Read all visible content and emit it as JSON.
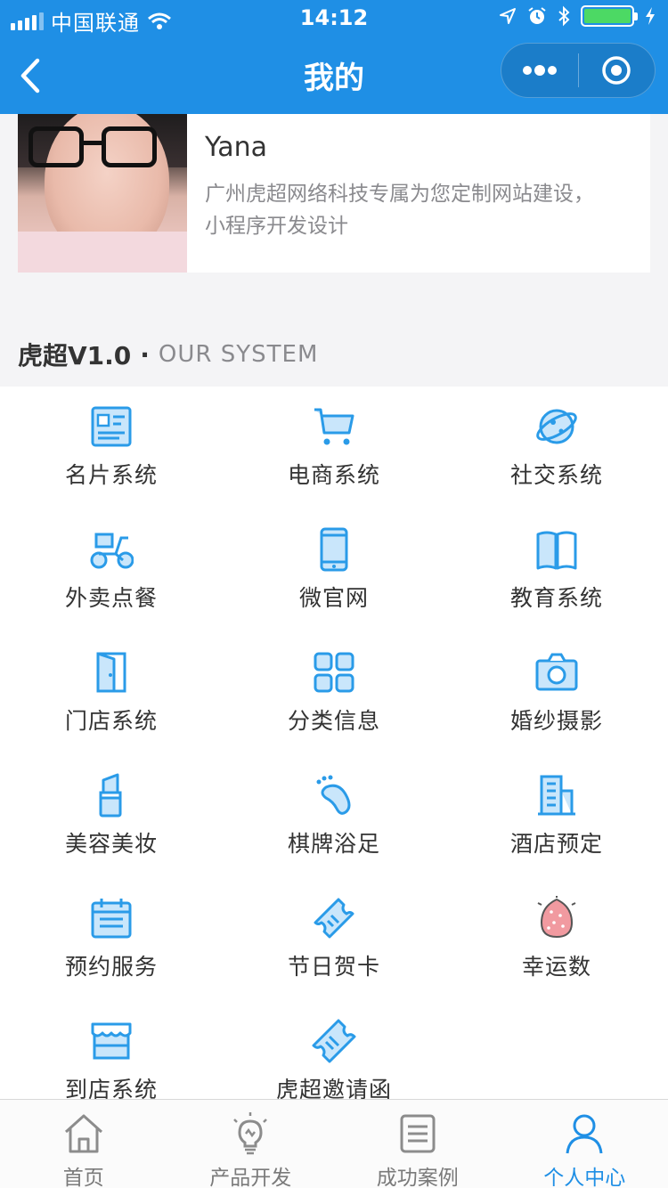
{
  "status_bar": {
    "carrier": "中国联通",
    "time": "14:12",
    "battery_level": 1.0
  },
  "nav": {
    "title": "我的"
  },
  "profile": {
    "name": "Yana",
    "description": "广州虎超网络科技专属为您定制网站建设，小程序开发设计"
  },
  "section": {
    "title": "虎超V1.0",
    "dot": "·",
    "subtitle": "OUR SYSTEM"
  },
  "grid": {
    "items": [
      {
        "label": "名片系统",
        "icon": "card-icon"
      },
      {
        "label": "电商系统",
        "icon": "cart-icon"
      },
      {
        "label": "社交系统",
        "icon": "planet-icon"
      },
      {
        "label": "外卖点餐",
        "icon": "scooter-icon"
      },
      {
        "label": "微官网",
        "icon": "phone-icon"
      },
      {
        "label": "教育系统",
        "icon": "book-icon"
      },
      {
        "label": "门店系统",
        "icon": "door-icon"
      },
      {
        "label": "分类信息",
        "icon": "category-grid-icon"
      },
      {
        "label": "婚纱摄影",
        "icon": "camera-icon"
      },
      {
        "label": "美容美妆",
        "icon": "lipstick-icon"
      },
      {
        "label": "棋牌浴足",
        "icon": "foot-icon"
      },
      {
        "label": "酒店预定",
        "icon": "building-icon"
      },
      {
        "label": "预约服务",
        "icon": "calendar-icon"
      },
      {
        "label": "节日贺卡",
        "icon": "ticket-icon"
      },
      {
        "label": "幸运数",
        "icon": "lucky-egg-icon"
      },
      {
        "label": "到店系统",
        "icon": "shop-icon"
      },
      {
        "label": "虎超邀请函",
        "icon": "invitation-icon"
      }
    ]
  },
  "tabbar": {
    "tabs": [
      {
        "label": "首页",
        "icon": "home-icon"
      },
      {
        "label": "产品开发",
        "icon": "lightbulb-icon"
      },
      {
        "label": "成功案例",
        "icon": "list-box-icon"
      },
      {
        "label": "个人中心",
        "icon": "person-icon",
        "active": true
      }
    ]
  },
  "colors": {
    "primary": "#1f8fe5",
    "icon_blue": "#2a9be8",
    "icon_fill": "#c9e6fb",
    "text": "#333333",
    "muted": "#8a8a8e",
    "lucky_egg": "#f19aa0"
  }
}
